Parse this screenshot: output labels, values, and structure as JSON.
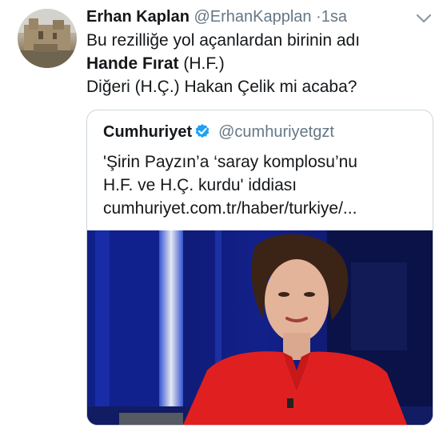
{
  "tweet": {
    "author_name": "Erhan Kaplan",
    "author_handle": "@ErhanKapplan",
    "separator": "·",
    "time": "1sa",
    "lines": [
      "Bu rezilliğe yol açanlardan birinin adı",
      "Hande Fırat",
      " (H.F.)",
      "Diğeri (H.Ç.) Hakan Çelik mi acaba?"
    ]
  },
  "quote": {
    "name": "Cumhuriyet",
    "handle": "@cumhuriyetgzt",
    "lines": [
      "'Şirin Payzın’a ‘saray komplosu’nu",
      "H.F. ve H.Ç. kurdu' iddiası",
      "cumhuriyet.com.tr/haber/turkiye/..."
    ],
    "image_description_icon": "news-photo"
  },
  "colors": {
    "text": "#14171a",
    "secondary": "#657786",
    "border": "#ccd6dd",
    "verified": "#1da1f2",
    "photo_bg": "#0d1a66",
    "shirt": "#e02020"
  }
}
